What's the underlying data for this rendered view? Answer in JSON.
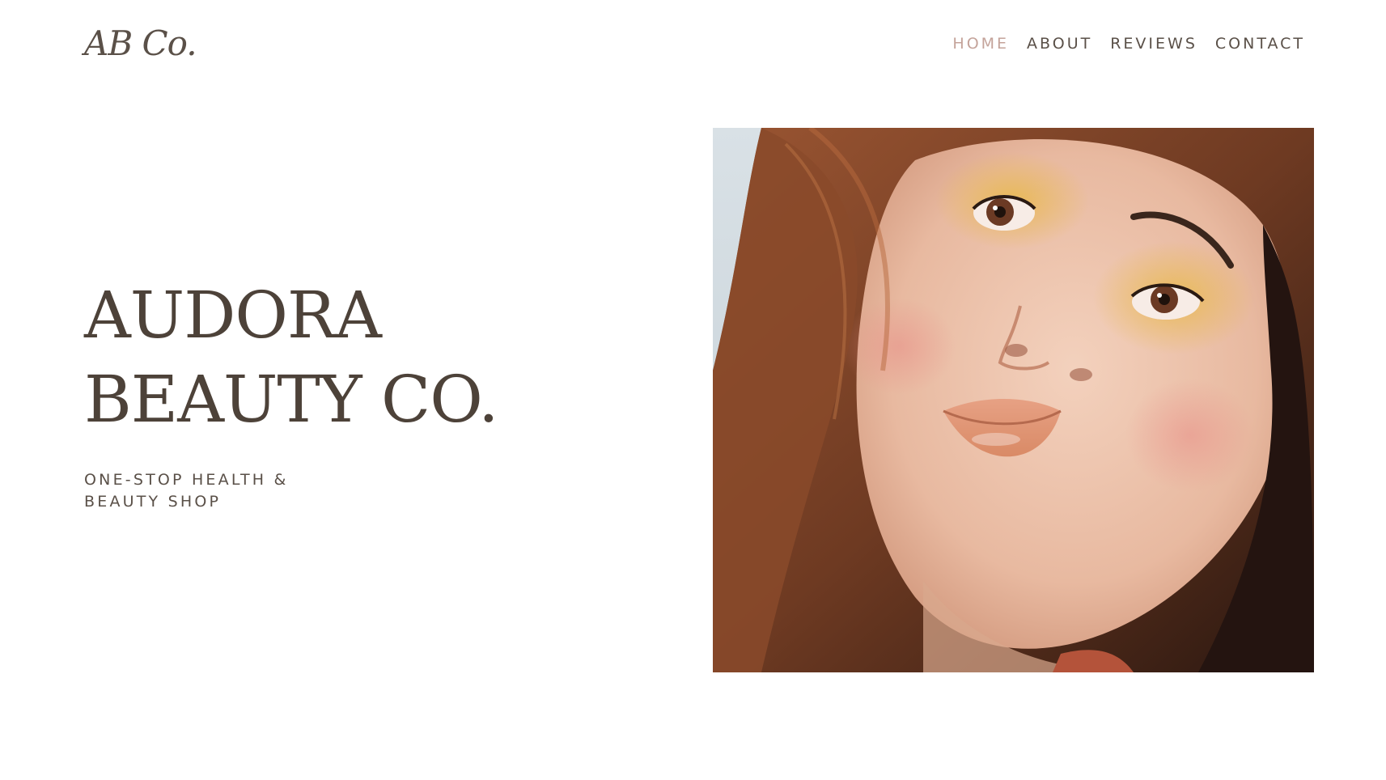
{
  "header": {
    "logo_text": "AB Co.",
    "nav": [
      {
        "label": "HOME",
        "active": true
      },
      {
        "label": "ABOUT",
        "active": false
      },
      {
        "label": "REVIEWS",
        "active": false
      },
      {
        "label": "CONTACT",
        "active": false
      }
    ]
  },
  "hero": {
    "title_line1": "AUDORA",
    "title_line2": "BEAUTY CO.",
    "tagline_line1": "ONE-STOP HEALTH &",
    "tagline_line2": "BEAUTY SHOP"
  },
  "colors": {
    "text": "#4d4239",
    "nav_active": "#c4a39a",
    "background": "#ffffff"
  }
}
